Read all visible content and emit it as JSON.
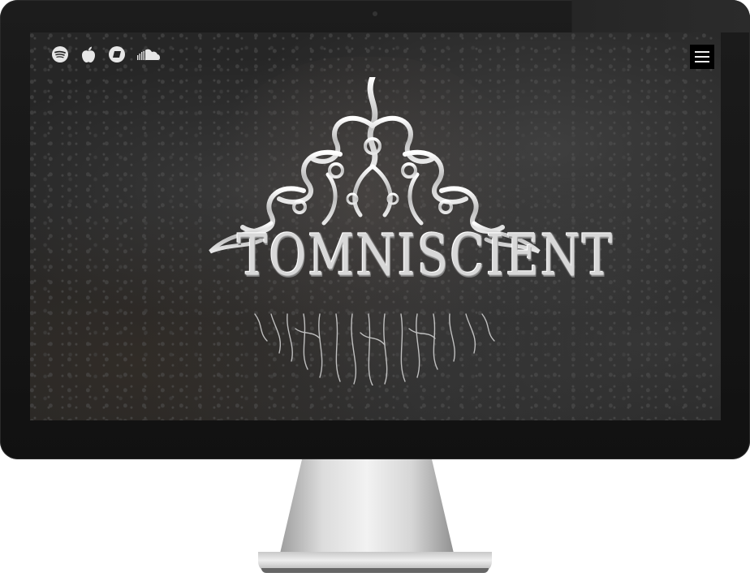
{
  "site": {
    "logo_text": "TOMNISCIENT"
  },
  "social": [
    {
      "icon": "spotify-icon"
    },
    {
      "icon": "apple-icon"
    },
    {
      "icon": "bandcamp-icon"
    },
    {
      "icon": "soundcloud-icon"
    }
  ],
  "menu": {
    "icon": "hamburger-menu-icon"
  },
  "colors": {
    "bezel": "#111111",
    "screen_bg": "#262626",
    "icon": "#e6e6e6",
    "logo": "#d8d8d8"
  }
}
